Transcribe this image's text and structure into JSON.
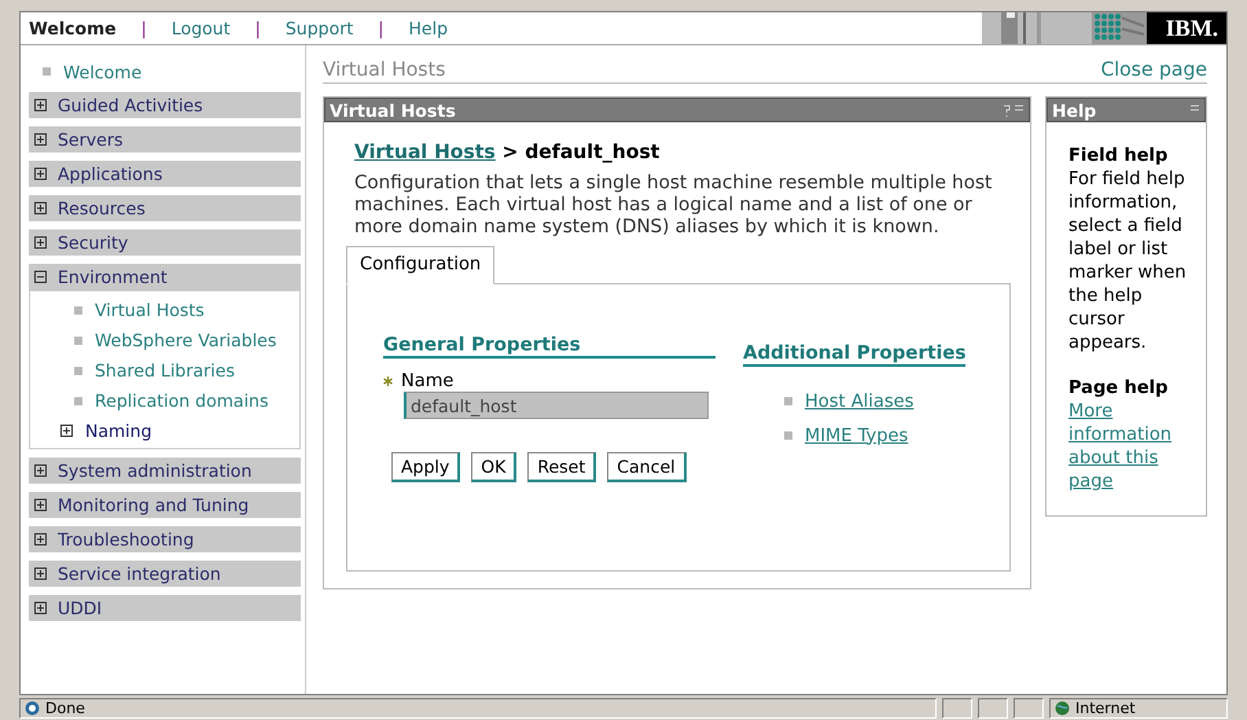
{
  "top_nav": {
    "separator": "|",
    "items": [
      {
        "label": "Welcome",
        "selected": true
      },
      {
        "label": "Logout",
        "selected": false
      },
      {
        "label": "Support",
        "selected": false
      },
      {
        "label": "Help",
        "selected": false
      }
    ]
  },
  "logo": {
    "text": "IBM."
  },
  "sidebar": {
    "items": [
      {
        "kind": "link",
        "label": "Welcome"
      },
      {
        "kind": "group",
        "label": "Guided Activities",
        "expanded": false
      },
      {
        "kind": "group",
        "label": "Servers",
        "expanded": false
      },
      {
        "kind": "group",
        "label": "Applications",
        "expanded": false
      },
      {
        "kind": "group",
        "label": "Resources",
        "expanded": false
      },
      {
        "kind": "group",
        "label": "Security",
        "expanded": false
      },
      {
        "kind": "group",
        "label": "Environment",
        "expanded": true,
        "children": [
          {
            "kind": "link",
            "label": "Virtual Hosts"
          },
          {
            "kind": "link",
            "label": "WebSphere Variables"
          },
          {
            "kind": "link",
            "label": "Shared Libraries"
          },
          {
            "kind": "link",
            "label": "Replication domains"
          },
          {
            "kind": "group",
            "label": "Naming",
            "expanded": false
          }
        ]
      },
      {
        "kind": "group",
        "label": "System administration",
        "expanded": false
      },
      {
        "kind": "group",
        "label": "Monitoring and Tuning",
        "expanded": false
      },
      {
        "kind": "group",
        "label": "Troubleshooting",
        "expanded": false
      },
      {
        "kind": "group",
        "label": "Service integration",
        "expanded": false
      },
      {
        "kind": "group",
        "label": "UDDI",
        "expanded": false
      }
    ]
  },
  "page": {
    "title": "Virtual Hosts",
    "close": "Close page"
  },
  "panel": {
    "title": "Virtual Hosts",
    "breadcrumb": {
      "link": "Virtual Hosts",
      "separator": ">",
      "current": "default_host"
    },
    "description": "Configuration that lets a single host machine resemble multiple host machines. Each virtual host has a logical name and a list of one or more domain name system (DNS) aliases by which it is known.",
    "tabs": [
      {
        "label": "Configuration",
        "selected": true
      }
    ],
    "general": {
      "heading": "General Properties",
      "fields": [
        {
          "label": "Name",
          "required": true,
          "value": "default_host"
        }
      ]
    },
    "buttons": [
      "Apply",
      "OK",
      "Reset",
      "Cancel"
    ],
    "additional": {
      "heading": "Additional Properties",
      "links": [
        "Host Aliases",
        "MIME Types"
      ]
    }
  },
  "help": {
    "title": "Help",
    "sections": [
      {
        "heading": "Field help",
        "text": "For field help information, select a field label or list marker when the help cursor appears."
      },
      {
        "heading": "Page help",
        "link": "More information about this page"
      }
    ]
  },
  "status_bar": {
    "text": "Done",
    "zone": "Internet"
  }
}
